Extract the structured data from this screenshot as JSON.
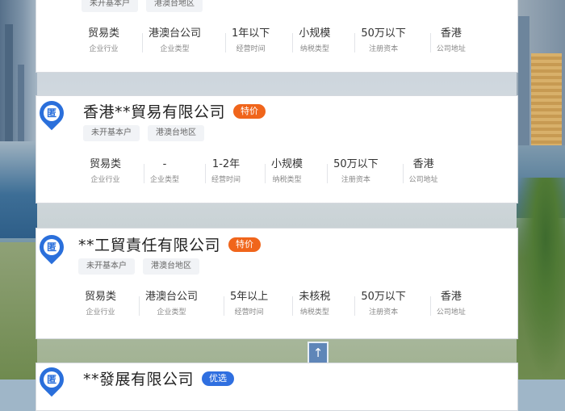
{
  "listings": [
    {
      "title": "",
      "badge": "",
      "tags": [
        "未开基本户",
        "港澳台地区"
      ],
      "stats": [
        {
          "value": "贸易类",
          "label": "企业行业"
        },
        {
          "value": "港澳台公司",
          "label": "企业类型"
        },
        {
          "value": "1年以下",
          "label": "经营时间"
        },
        {
          "value": "小规模",
          "label": "纳税类型"
        },
        {
          "value": "50万以下",
          "label": "注册资本"
        },
        {
          "value": "香港",
          "label": "公司地址"
        }
      ]
    },
    {
      "title": "香港**貿易有限公司",
      "badge": "特价",
      "tags": [
        "未开基本户",
        "港澳台地区"
      ],
      "stats": [
        {
          "value": "贸易类",
          "label": "企业行业"
        },
        {
          "value": "-",
          "label": "企业类型"
        },
        {
          "value": "1-2年",
          "label": "经营时间"
        },
        {
          "value": "小规模",
          "label": "纳税类型"
        },
        {
          "value": "50万以下",
          "label": "注册资本"
        },
        {
          "value": "香港",
          "label": "公司地址"
        }
      ]
    },
    {
      "title": "**工貿責任有限公司",
      "badge": "特价",
      "tags": [
        "未开基本户",
        "港澳台地区"
      ],
      "stats": [
        {
          "value": "贸易类",
          "label": "企业行业"
        },
        {
          "value": "港澳台公司",
          "label": "企业类型"
        },
        {
          "value": "5年以上",
          "label": "经营时间"
        },
        {
          "value": "未核税",
          "label": "纳税类型"
        },
        {
          "value": "50万以下",
          "label": "注册资本"
        },
        {
          "value": "香港",
          "label": "公司地址"
        }
      ]
    },
    {
      "title": "**發展有限公司",
      "badge": "优选"
    }
  ],
  "icons": {
    "location_pin": "location-pin-icon",
    "pin_glyph": "匿",
    "scroll_arrow": "↑"
  },
  "colors": {
    "pin": "#2a6fdb",
    "badge_special": "#f0651b",
    "badge_best": "#2f6fe0"
  }
}
